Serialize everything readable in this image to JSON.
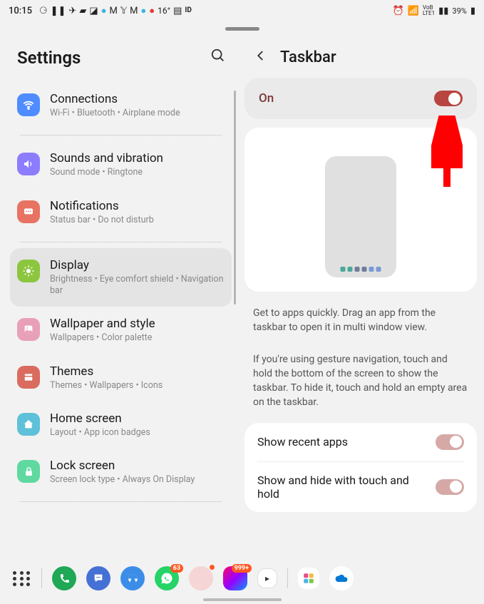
{
  "status": {
    "time": "10:15",
    "battery": "39%",
    "temp": "16°",
    "net": "LTE1"
  },
  "left": {
    "title": "Settings",
    "items": [
      {
        "name": "connections",
        "title": "Connections",
        "sub": "Wi-Fi  •  Bluetooth  •  Airplane mode",
        "bg": "#4e8cff",
        "glyph": "὏6"
      },
      {
        "name": "sounds",
        "title": "Sounds and vibration",
        "sub": "Sound mode  •  Ringtone",
        "bg": "#8c7dff",
        "glyph": "🔊"
      },
      {
        "name": "notifications",
        "title": "Notifications",
        "sub": "Status bar  •  Do not disturb",
        "bg": "#e87362",
        "glyph": "💬"
      },
      {
        "name": "display",
        "title": "Display",
        "sub": "Brightness  •  Eye comfort shield  •  Navigation bar",
        "bg": "#8cc63f",
        "glyph": "☀"
      },
      {
        "name": "wallpaper",
        "title": "Wallpaper and style",
        "sub": "Wallpapers  •  Color palette",
        "bg": "#e8a0b8",
        "glyph": "🖼"
      },
      {
        "name": "themes",
        "title": "Themes",
        "sub": "Themes  •  Wallpapers  •  Icons",
        "bg": "#d96c5f",
        "glyph": "▣"
      },
      {
        "name": "homescreen",
        "title": "Home screen",
        "sub": "Layout  •  App icon badges",
        "bg": "#5fc1d9",
        "glyph": "⌂"
      },
      {
        "name": "lockscreen",
        "title": "Lock screen",
        "sub": "Screen lock type  •  Always On Display",
        "bg": "#5fd9a0",
        "glyph": "🔒"
      }
    ]
  },
  "right": {
    "title": "Taskbar",
    "on_label": "On",
    "desc1": "Get to apps quickly. Drag an app from the taskbar to open it in multi window view.",
    "desc2": "If you're using gesture navigation, touch and hold the bottom of the screen to show the taskbar. To hide it, touch and hold an empty area on the taskbar.",
    "options": [
      {
        "label": "Show recent apps"
      },
      {
        "label": "Show and hide with touch and hold"
      }
    ]
  },
  "dock": {
    "badge1": "63",
    "badge2": "999+"
  }
}
